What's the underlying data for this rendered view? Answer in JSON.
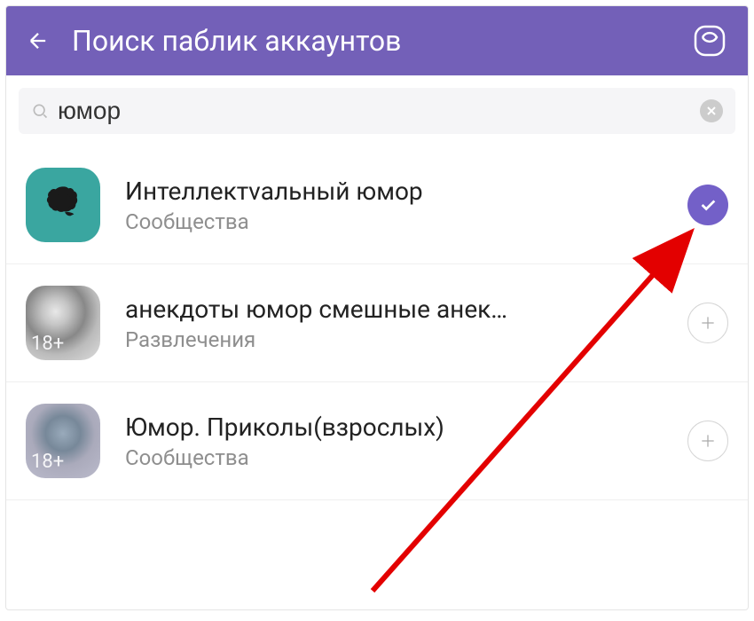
{
  "header": {
    "title": "Поиск паблик аккаунтов"
  },
  "search": {
    "value": "юмор"
  },
  "results": [
    {
      "title": "Интеллектvальный юмор",
      "subtitle": "Сообщества",
      "badge": "",
      "subscribed": true
    },
    {
      "title": "анекдоты юмор смешные анек…",
      "subtitle": "Развлечения",
      "badge": "18+",
      "subscribed": false
    },
    {
      "title": "Юмор. Приколы(взрослых)",
      "subtitle": "Сообщества",
      "badge": "18+",
      "subscribed": false
    }
  ]
}
